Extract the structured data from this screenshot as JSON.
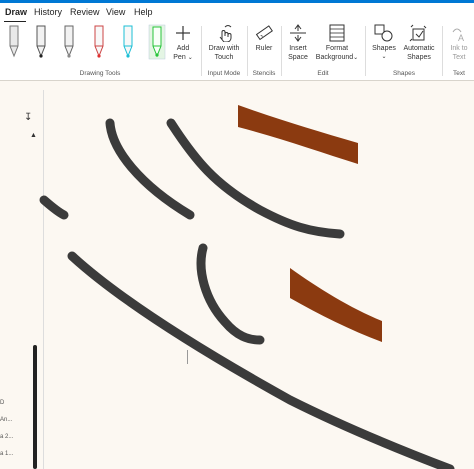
{
  "menu": {
    "items": [
      "Draw",
      "History",
      "Review",
      "View",
      "Help"
    ],
    "active": "Draw"
  },
  "ribbon": {
    "drawing_tools": {
      "label": "Drawing Tools",
      "pens": [
        {
          "name": "pencil-tool-icon",
          "color": "#e6e6e6"
        },
        {
          "name": "pen-black-icon",
          "color": "#222222"
        },
        {
          "name": "pen-gray-icon",
          "color": "#8a8a8a"
        },
        {
          "name": "pen-red-icon",
          "color": "#e03030"
        },
        {
          "name": "highlighter-cyan-icon",
          "color": "#1bbfd6"
        },
        {
          "name": "highlighter-green-icon",
          "color": "#27c43a"
        }
      ],
      "add_pen_line1": "Add",
      "add_pen_line2": "Pen"
    },
    "input_mode": {
      "label": "Input Mode",
      "draw_touch_line1": "Draw with",
      "draw_touch_line2": "Touch"
    },
    "stencils": {
      "label": "Stencils",
      "ruler": "Ruler"
    },
    "edit": {
      "label": "Edit",
      "insert_line1": "Insert",
      "insert_line2": "Space",
      "format_line1": "Format",
      "format_line2": "Background"
    },
    "shapes": {
      "label": "Shapes",
      "shapes_btn": "Shapes",
      "auto_line1": "Automatic",
      "auto_line2": "Shapes"
    },
    "text": {
      "label": "Text",
      "ink_line1": "Ink to",
      "ink_line2": "Text"
    }
  },
  "page_list": {
    "items": [
      "D",
      "An...",
      "a 2...",
      "a 1..."
    ]
  },
  "colors": {
    "accent": "#0078d4",
    "ink_dark": "#3b3b3b",
    "ink_brown": "#8b3a10",
    "canvas": "#fcf8f2"
  }
}
